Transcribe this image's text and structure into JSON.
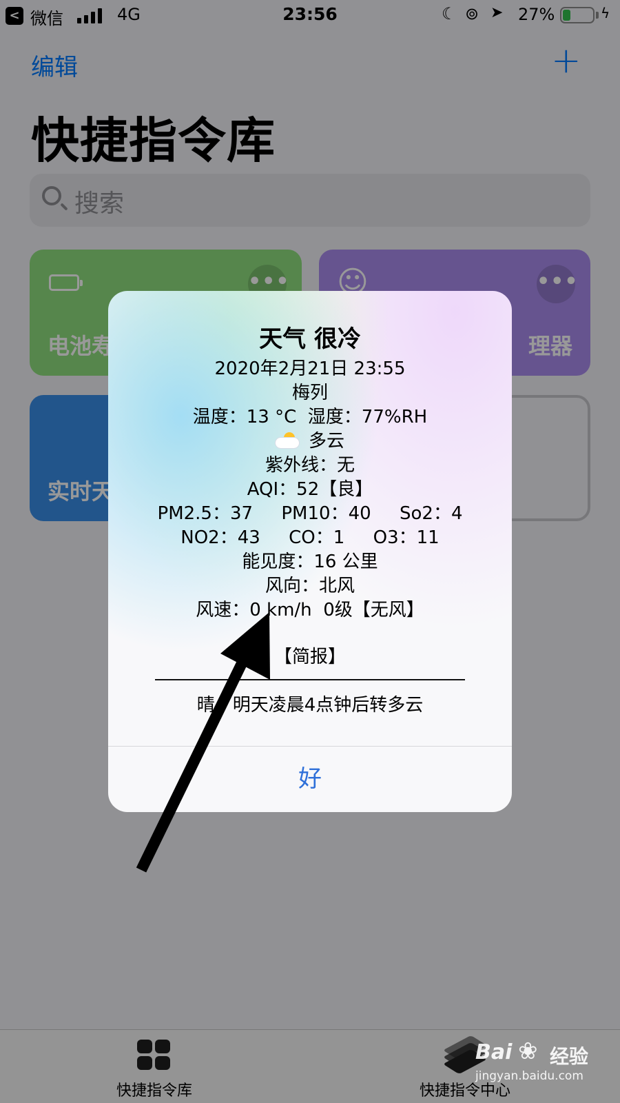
{
  "status_bar": {
    "back_app": "微信",
    "network": "4G",
    "time": "23:56",
    "battery_percent": "27%",
    "battery_level": 0.27,
    "battery_color": "#32c24d"
  },
  "header": {
    "edit_label": "编辑",
    "add_icon": "plus-icon",
    "title": "快捷指令库"
  },
  "search": {
    "placeholder": "搜索"
  },
  "shortcuts": [
    {
      "label": "电池寿",
      "color": "#8fe07f",
      "icon": "battery-icon"
    },
    {
      "label": "理器",
      "color": "#aa8cee",
      "icon": "smiley-icon"
    },
    {
      "label": "实时天",
      "color": "#3a8ee8",
      "icon": ""
    },
    {
      "label": "",
      "color": "#f2f2f7",
      "icon": ""
    }
  ],
  "alert": {
    "title": "天气 很冷",
    "lines": [
      "2020年2月21日 23:55",
      "梅列",
      "温度：13 °C  湿度：77%RH",
      "多云",
      "紫外线：无",
      "AQI：52【良】",
      "PM2.5：37     PM10：40     So2：4",
      "NO2：43     CO：1     O3：11",
      "能见度：16 公里",
      "风向：北风",
      "风速：0 km/h  0级【无风】"
    ],
    "brief_label": "【简报】",
    "summary": "晴，明天凌晨4点钟后转多云",
    "ok_label": "好",
    "ok_color": "#2f70d9"
  },
  "tabbar": {
    "tabs": [
      {
        "label": "快捷指令库",
        "icon": "grid-icon"
      },
      {
        "label": "快捷指令中心",
        "icon": "stack-icon"
      }
    ]
  },
  "watermark": {
    "brand_a": "Bai",
    "brand_b": "经验",
    "url": "jingyan.baidu.com"
  }
}
